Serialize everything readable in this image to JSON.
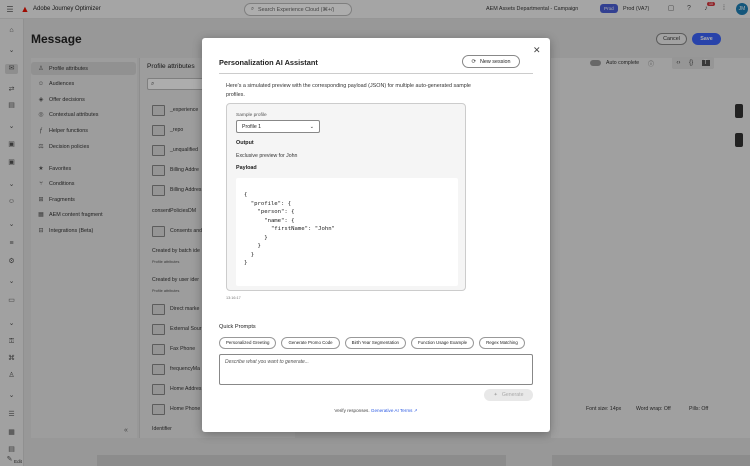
{
  "topbar": {
    "app_name": "Adobe Journey Optimizer",
    "search_placeholder": "Search Experience Cloud (⌘+/)",
    "org_name": "AEM Assets Departmental - Campaign",
    "env_badge": "Prod",
    "env_name": "Prod (VA7)",
    "notification_count": "10",
    "avatar_initial": "JM"
  },
  "page": {
    "title": "Message",
    "cancel_label": "Cancel",
    "save_label": "Save"
  },
  "left_nav": {
    "items": [
      {
        "label": "Profile attributes",
        "icon": "user-icon"
      },
      {
        "label": "Audiences",
        "icon": "audience-icon"
      },
      {
        "label": "Offer decisions",
        "icon": "offer-icon"
      },
      {
        "label": "Contextual attributes",
        "icon": "context-icon"
      },
      {
        "label": "Helper functions",
        "icon": "function-icon"
      },
      {
        "label": "Decision policies",
        "icon": "policy-icon"
      },
      {
        "label": "Favorites",
        "icon": "star-icon"
      },
      {
        "label": "Conditions",
        "icon": "condition-icon"
      },
      {
        "label": "Fragments",
        "icon": "fragment-icon"
      },
      {
        "label": "AEM content fragment",
        "icon": "aem-fragment-icon"
      },
      {
        "label": "Integrations (Beta)",
        "icon": "integration-icon"
      }
    ]
  },
  "attr_panel": {
    "title": "Profile attributes",
    "rows": [
      "_experience",
      "_repo",
      "_unqualified",
      "Billing Addre",
      "Billing Addres",
      "consentPoliciesDM",
      "Consents and",
      "Created by batch ide",
      "Profile attributes",
      "Created by user ider",
      "Profile attributes",
      "Direct marke",
      "External Sour",
      "Fax Phone",
      "frequencyMa",
      "Home Addres",
      "Home Phone",
      "Identifier"
    ]
  },
  "editor": {
    "autocomplete_label": "Auto complete",
    "font_size": "Font size: 14px",
    "word_wrap": "Word wrap: Off",
    "pills": "Pills: Off",
    "edit_label": "Edit"
  },
  "dialog": {
    "title": "Personalization AI Assistant",
    "new_session_label": "New session",
    "description": "Here's a simulated preview with the corresponding payload (JSON) for multiple auto-generated sample profiles.",
    "sample_profile_label": "Sample profile",
    "sample_profile_value": "Profile 1",
    "output_label": "Output",
    "output_text": "Exclusive preview for John",
    "payload_label": "Payload",
    "payload_code": "{\n  \"profile\": {\n    \"person\": {\n      \"name\": {\n        \"firstName\": \"John\"\n      }\n    }\n  }\n}",
    "timestamp": "13:16:17",
    "quick_prompts_label": "Quick Prompts",
    "quick_prompts": [
      "Personalized Greeting",
      "Generate Promo Code",
      "Birth Year Segmentation",
      "Function Usage Example",
      "Regex Matching"
    ],
    "prompt_placeholder": "Describe what you want to generate...",
    "generate_label": "Generate",
    "verify_text": "Verify responses.",
    "terms_link": "Generative AI Terms"
  }
}
